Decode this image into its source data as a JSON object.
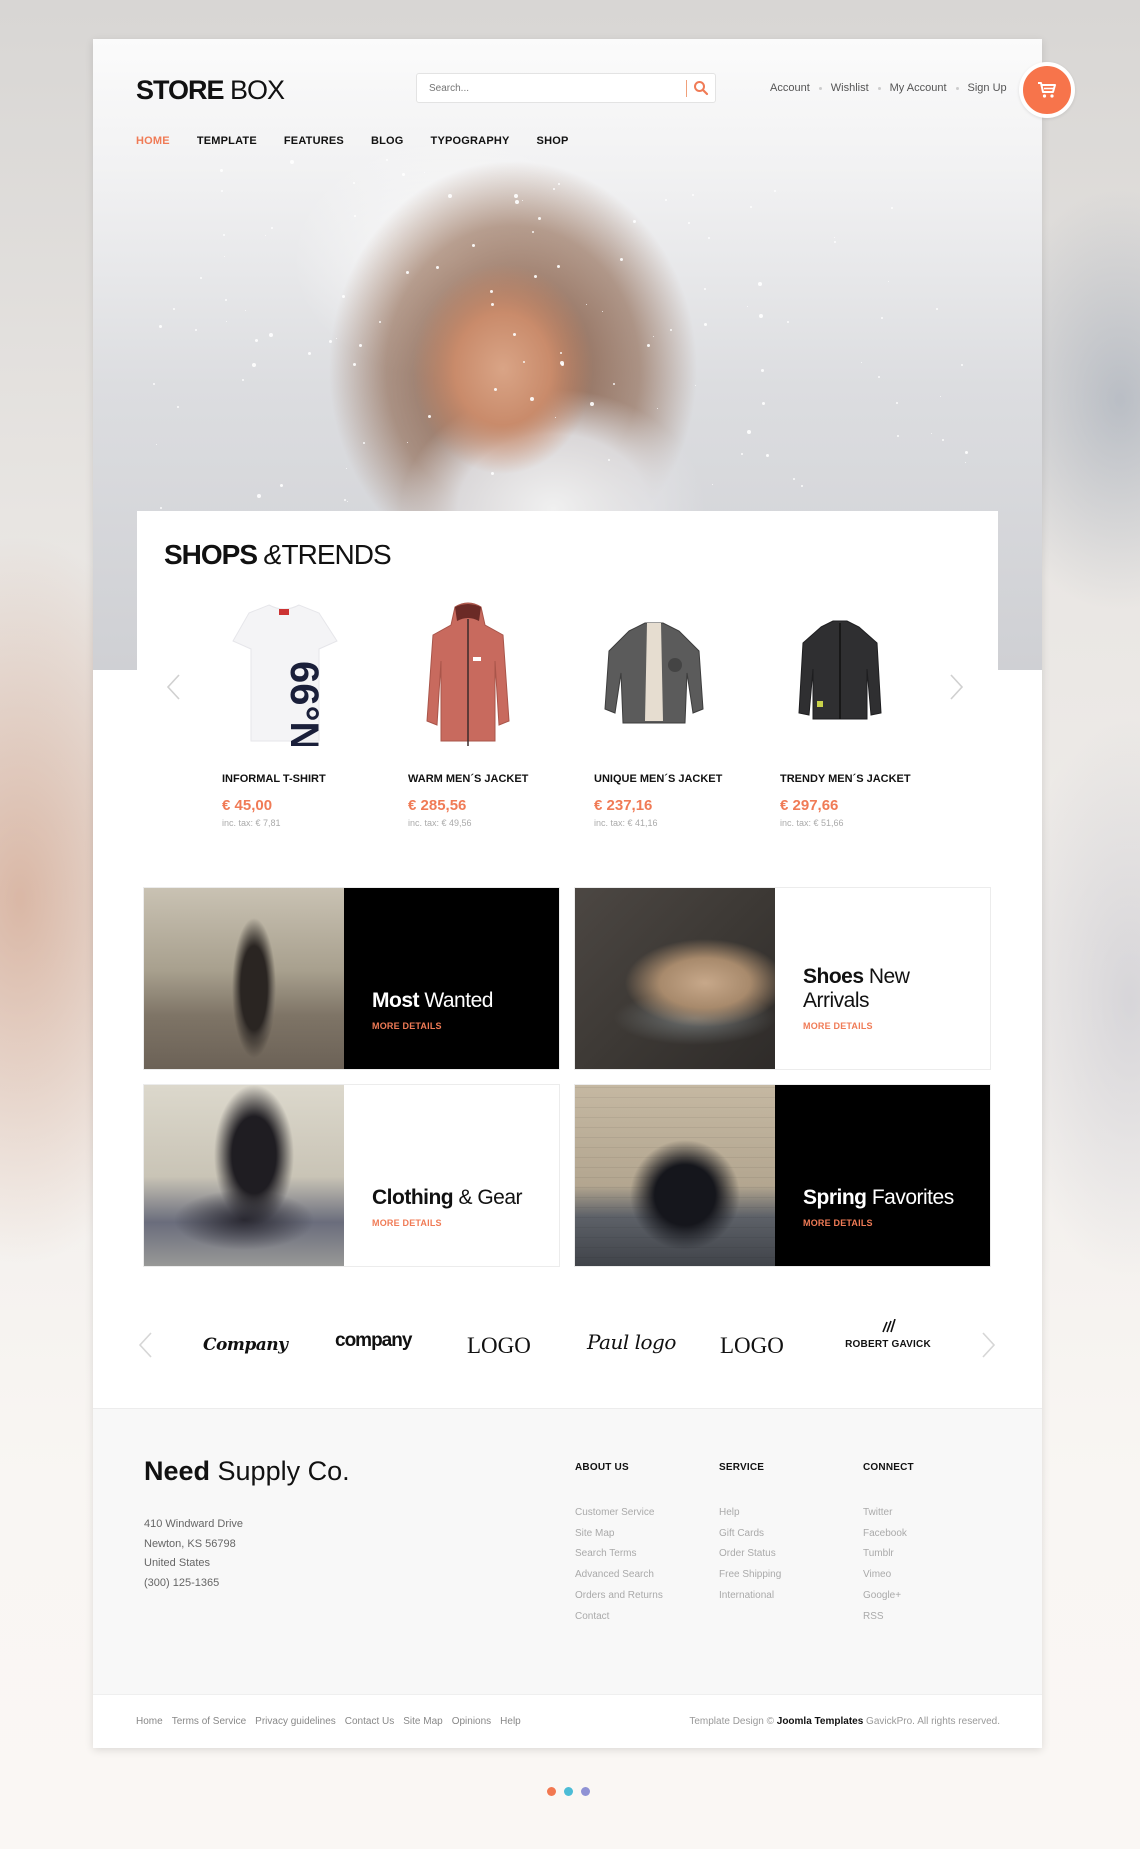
{
  "header": {
    "logo_bold": "STORE",
    "logo_light": " BOX",
    "search_placeholder": "Search...",
    "top_links": [
      "Account",
      "Wishlist",
      "My Account",
      "Sign Up"
    ],
    "cart_icon": "shopping-cart-icon"
  },
  "nav": {
    "items": [
      {
        "label": "HOME",
        "active": true
      },
      {
        "label": "TEMPLATE",
        "active": false
      },
      {
        "label": "FEATURES",
        "active": false
      },
      {
        "label": "BLOG",
        "active": false
      },
      {
        "label": "TYPOGRAPHY",
        "active": false
      },
      {
        "label": "SHOP",
        "active": false
      }
    ]
  },
  "shops": {
    "title_bold": "SHOPS",
    "title_amp": " &",
    "title_light": "TRENDS",
    "products": [
      {
        "name": "INFORMAL T-SHIRT",
        "price": "€ 45,00",
        "tax": "inc. tax: € 7,81",
        "image": "white t-shirt"
      },
      {
        "name": "WARM MEN´S JACKET",
        "price": "€ 285,56",
        "tax": "inc. tax: € 49,56",
        "image": "red jacket"
      },
      {
        "name": "UNIQUE MEN´S JACKET",
        "price": "€ 237,16",
        "tax": "inc. tax: € 41,16",
        "image": "grey jacket"
      },
      {
        "name": "TRENDY MEN´S JACKET",
        "price": "€ 297,66",
        "tax": "inc. tax: € 51,66",
        "image": "black jacket"
      }
    ]
  },
  "promos": [
    {
      "bold": "Most",
      "light": " Wanted",
      "link": "MORE DETAILS",
      "theme": "dark"
    },
    {
      "bold": "Shoes",
      "light": " New Arrivals",
      "link": "MORE DETAILS",
      "theme": "light"
    },
    {
      "bold": "Clothing",
      "light": " & Gear",
      "link": "MORE DETAILS",
      "theme": "light"
    },
    {
      "bold": "Spring",
      "light": " Favorites",
      "link": "MORE DETAILS",
      "theme": "dark"
    }
  ],
  "brands": [
    "Company",
    "company",
    "LOGO",
    "Paul logo",
    "LOGO",
    "ROBERT GAVICK"
  ],
  "footer": {
    "company_bold": "Need",
    "company_light": " Supply Co.",
    "address": [
      "410 Windward Drive",
      "Newton, KS 56798",
      "United States",
      "(300) 125-1365"
    ],
    "columns": [
      {
        "title": "ABOUT US",
        "links": [
          "Customer Service",
          "Site Map",
          "Search Terms",
          "Advanced Search",
          "Orders and Returns",
          "Contact"
        ]
      },
      {
        "title": "SERVICE",
        "links": [
          "Help",
          "Gift Cards",
          "Order Status",
          "Free Shipping",
          "International"
        ]
      },
      {
        "title": "CONNECT",
        "links": [
          "Twitter",
          "Facebook",
          "Tumblr",
          "Vimeo",
          "Google+",
          "RSS"
        ]
      }
    ],
    "bottom_links": [
      "Home",
      "Terms of Service",
      "Privacy guidelines",
      "Contact Us",
      "Site Map",
      "Opinions",
      "Help"
    ],
    "copyright_pre": "Template Design © ",
    "copyright_bold": "Joomla Templates",
    "copyright_post": " GavickPro. All rights reserved."
  },
  "colors": {
    "accent": "#f07b56",
    "cart": "#f7744b",
    "dots": [
      "#f27850",
      "#4bbcd6",
      "#8f92d4"
    ]
  }
}
